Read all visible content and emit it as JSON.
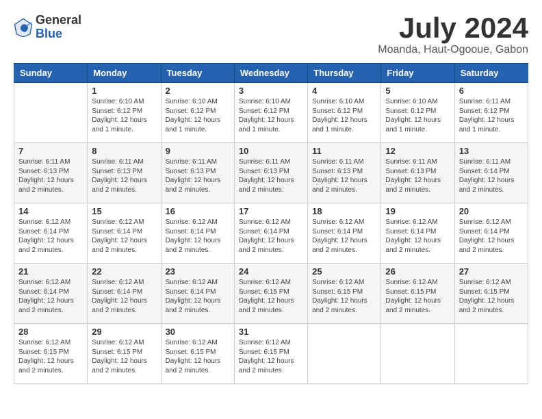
{
  "logo": {
    "general": "General",
    "blue": "Blue"
  },
  "title": "July 2024",
  "location": "Moanda, Haut-Ogooue, Gabon",
  "weekdays": [
    "Sunday",
    "Monday",
    "Tuesday",
    "Wednesday",
    "Thursday",
    "Friday",
    "Saturday"
  ],
  "weeks": [
    [
      {
        "day": "",
        "info": ""
      },
      {
        "day": "1",
        "info": "Sunrise: 6:10 AM\nSunset: 6:12 PM\nDaylight: 12 hours\nand 1 minute."
      },
      {
        "day": "2",
        "info": "Sunrise: 6:10 AM\nSunset: 6:12 PM\nDaylight: 12 hours\nand 1 minute."
      },
      {
        "day": "3",
        "info": "Sunrise: 6:10 AM\nSunset: 6:12 PM\nDaylight: 12 hours\nand 1 minute."
      },
      {
        "day": "4",
        "info": "Sunrise: 6:10 AM\nSunset: 6:12 PM\nDaylight: 12 hours\nand 1 minute."
      },
      {
        "day": "5",
        "info": "Sunrise: 6:10 AM\nSunset: 6:12 PM\nDaylight: 12 hours\nand 1 minute."
      },
      {
        "day": "6",
        "info": "Sunrise: 6:11 AM\nSunset: 6:12 PM\nDaylight: 12 hours\nand 1 minute."
      }
    ],
    [
      {
        "day": "7",
        "info": "Sunrise: 6:11 AM\nSunset: 6:13 PM\nDaylight: 12 hours\nand 2 minutes."
      },
      {
        "day": "8",
        "info": "Sunrise: 6:11 AM\nSunset: 6:13 PM\nDaylight: 12 hours\nand 2 minutes."
      },
      {
        "day": "9",
        "info": "Sunrise: 6:11 AM\nSunset: 6:13 PM\nDaylight: 12 hours\nand 2 minutes."
      },
      {
        "day": "10",
        "info": "Sunrise: 6:11 AM\nSunset: 6:13 PM\nDaylight: 12 hours\nand 2 minutes."
      },
      {
        "day": "11",
        "info": "Sunrise: 6:11 AM\nSunset: 6:13 PM\nDaylight: 12 hours\nand 2 minutes."
      },
      {
        "day": "12",
        "info": "Sunrise: 6:11 AM\nSunset: 6:13 PM\nDaylight: 12 hours\nand 2 minutes."
      },
      {
        "day": "13",
        "info": "Sunrise: 6:11 AM\nSunset: 6:14 PM\nDaylight: 12 hours\nand 2 minutes."
      }
    ],
    [
      {
        "day": "14",
        "info": "Sunrise: 6:12 AM\nSunset: 6:14 PM\nDaylight: 12 hours\nand 2 minutes."
      },
      {
        "day": "15",
        "info": "Sunrise: 6:12 AM\nSunset: 6:14 PM\nDaylight: 12 hours\nand 2 minutes."
      },
      {
        "day": "16",
        "info": "Sunrise: 6:12 AM\nSunset: 6:14 PM\nDaylight: 12 hours\nand 2 minutes."
      },
      {
        "day": "17",
        "info": "Sunrise: 6:12 AM\nSunset: 6:14 PM\nDaylight: 12 hours\nand 2 minutes."
      },
      {
        "day": "18",
        "info": "Sunrise: 6:12 AM\nSunset: 6:14 PM\nDaylight: 12 hours\nand 2 minutes."
      },
      {
        "day": "19",
        "info": "Sunrise: 6:12 AM\nSunset: 6:14 PM\nDaylight: 12 hours\nand 2 minutes."
      },
      {
        "day": "20",
        "info": "Sunrise: 6:12 AM\nSunset: 6:14 PM\nDaylight: 12 hours\nand 2 minutes."
      }
    ],
    [
      {
        "day": "21",
        "info": "Sunrise: 6:12 AM\nSunset: 6:14 PM\nDaylight: 12 hours\nand 2 minutes."
      },
      {
        "day": "22",
        "info": "Sunrise: 6:12 AM\nSunset: 6:14 PM\nDaylight: 12 hours\nand 2 minutes."
      },
      {
        "day": "23",
        "info": "Sunrise: 6:12 AM\nSunset: 6:14 PM\nDaylight: 12 hours\nand 2 minutes."
      },
      {
        "day": "24",
        "info": "Sunrise: 6:12 AM\nSunset: 6:15 PM\nDaylight: 12 hours\nand 2 minutes."
      },
      {
        "day": "25",
        "info": "Sunrise: 6:12 AM\nSunset: 6:15 PM\nDaylight: 12 hours\nand 2 minutes."
      },
      {
        "day": "26",
        "info": "Sunrise: 6:12 AM\nSunset: 6:15 PM\nDaylight: 12 hours\nand 2 minutes."
      },
      {
        "day": "27",
        "info": "Sunrise: 6:12 AM\nSunset: 6:15 PM\nDaylight: 12 hours\nand 2 minutes."
      }
    ],
    [
      {
        "day": "28",
        "info": "Sunrise: 6:12 AM\nSunset: 6:15 PM\nDaylight: 12 hours\nand 2 minutes."
      },
      {
        "day": "29",
        "info": "Sunrise: 6:12 AM\nSunset: 6:15 PM\nDaylight: 12 hours\nand 2 minutes."
      },
      {
        "day": "30",
        "info": "Sunrise: 6:12 AM\nSunset: 6:15 PM\nDaylight: 12 hours\nand 2 minutes."
      },
      {
        "day": "31",
        "info": "Sunrise: 6:12 AM\nSunset: 6:15 PM\nDaylight: 12 hours\nand 2 minutes."
      },
      {
        "day": "",
        "info": ""
      },
      {
        "day": "",
        "info": ""
      },
      {
        "day": "",
        "info": ""
      }
    ]
  ]
}
